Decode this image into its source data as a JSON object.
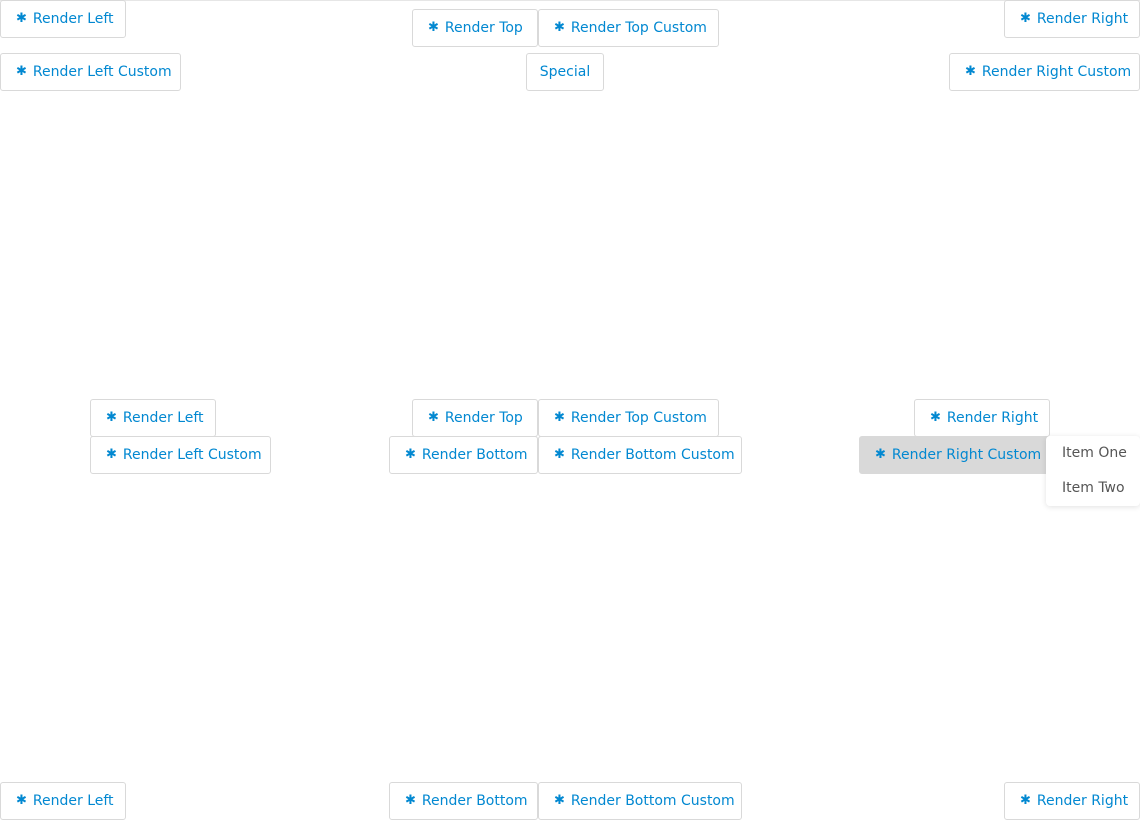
{
  "colors": {
    "accent": "#0288d1",
    "border": "#d9d9d9",
    "active_bg": "#d9d9d9",
    "menu_text": "#555555"
  },
  "icon": "asterisk-icon",
  "top_row": {
    "render_left": "Render Left",
    "render_top": "Render Top",
    "render_top_custom": "Render Top Custom",
    "render_right": "Render Right",
    "render_left_custom": "Render Left Custom",
    "special": "Special",
    "render_right_custom": "Render Right Custom"
  },
  "middle_row": {
    "render_left": "Render Left",
    "render_left_custom": "Render Left Custom",
    "render_top": "Render Top",
    "render_top_custom": "Render Top Custom",
    "render_bottom": "Render Bottom",
    "render_bottom_custom": "Render Bottom Custom",
    "render_right": "Render Right",
    "render_right_custom": "Render Right Custom"
  },
  "bottom_row": {
    "render_left": "Render Left",
    "render_bottom": "Render Bottom",
    "render_bottom_custom": "Render Bottom Custom",
    "render_right": "Render Right"
  },
  "dropdown_menu": {
    "items": [
      "Item One",
      "Item Two"
    ]
  }
}
